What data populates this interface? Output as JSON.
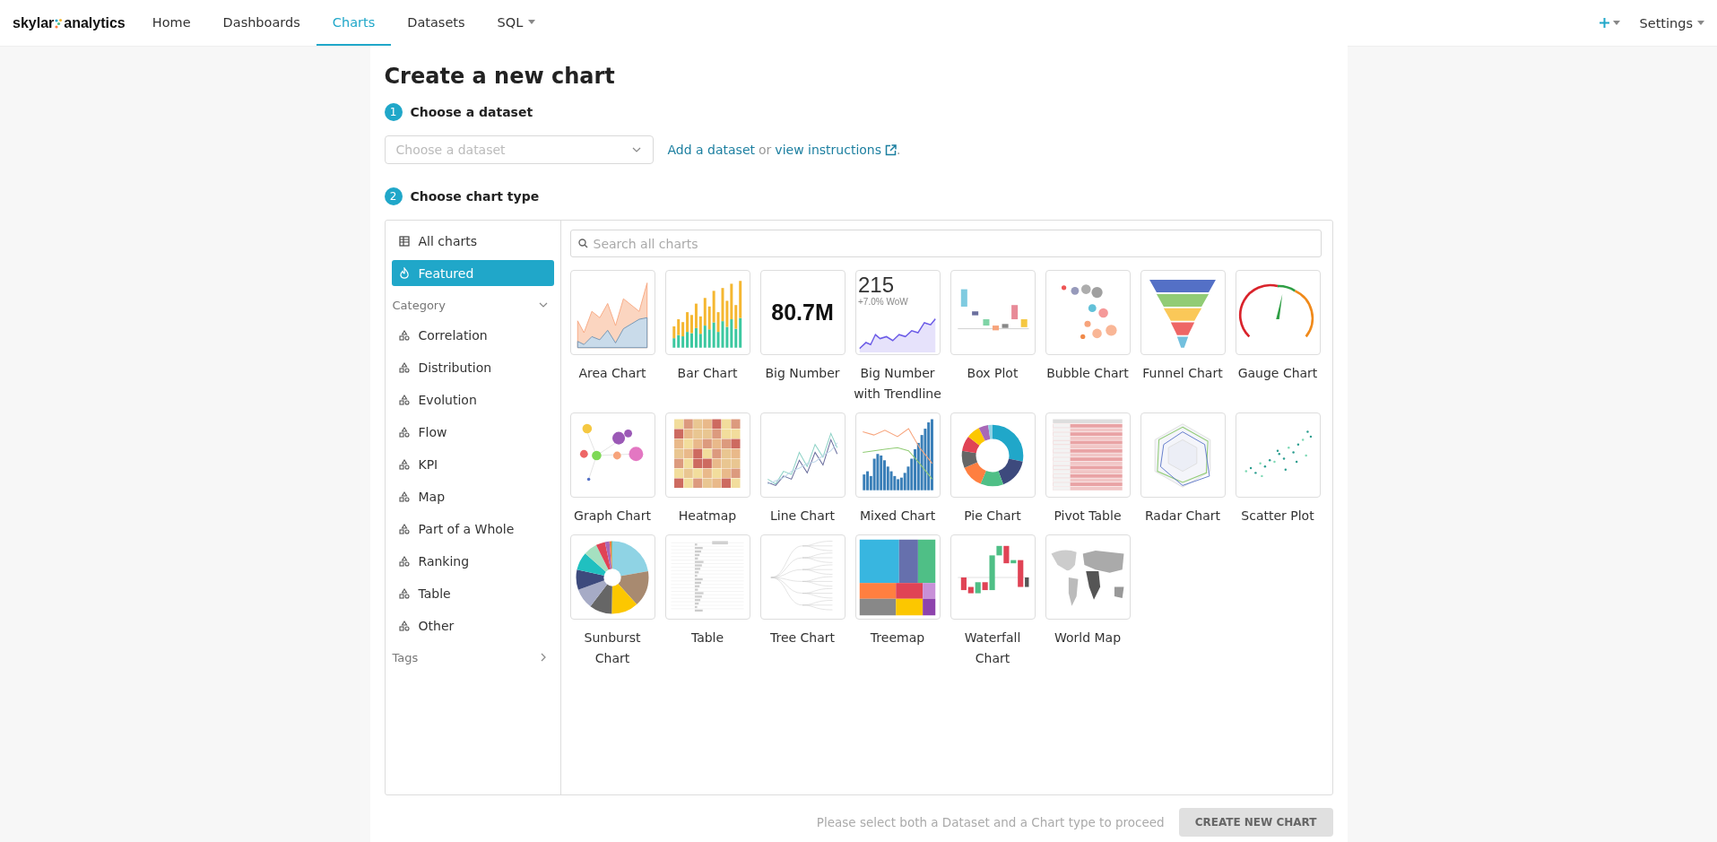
{
  "nav": {
    "brand": {
      "left": "skylar",
      "right": "analytics"
    },
    "items": [
      {
        "label": "Home",
        "selected": false,
        "dropdown": false
      },
      {
        "label": "Dashboards",
        "selected": false,
        "dropdown": false
      },
      {
        "label": "Charts",
        "selected": true,
        "dropdown": false
      },
      {
        "label": "Datasets",
        "selected": false,
        "dropdown": false
      },
      {
        "label": "SQL",
        "selected": false,
        "dropdown": true
      }
    ],
    "settings": "Settings"
  },
  "title": "Create a new chart",
  "steps": [
    {
      "number": "1",
      "label": "Choose a dataset"
    },
    {
      "number": "2",
      "label": "Choose chart type"
    }
  ],
  "dataset_select": {
    "placeholder": "Choose a dataset"
  },
  "dataset_hint": {
    "link_add": "Add a dataset",
    "or": "or",
    "link_instructions": "view instructions",
    "end": "."
  },
  "sidebar": {
    "items": [
      {
        "label": "All charts",
        "kind": "all",
        "selected": false
      },
      {
        "label": "Featured",
        "kind": "featured",
        "selected": true
      }
    ],
    "category": {
      "label": "Category",
      "expanded": true,
      "items": [
        {
          "label": "Correlation",
          "selected": false
        },
        {
          "label": "Distribution",
          "selected": false
        },
        {
          "label": "Evolution",
          "selected": false
        },
        {
          "label": "Flow",
          "selected": false
        },
        {
          "label": "KPI",
          "selected": false
        },
        {
          "label": "Map",
          "selected": false
        },
        {
          "label": "Part of a Whole",
          "selected": false
        },
        {
          "label": "Ranking",
          "selected": false
        },
        {
          "label": "Table",
          "selected": false
        },
        {
          "label": "Other",
          "selected": false
        }
      ]
    },
    "tags": {
      "label": "Tags",
      "expanded": false
    }
  },
  "search": {
    "placeholder": "Search all charts"
  },
  "charts": [
    {
      "label": "Area Chart",
      "kind": "area",
      "selected": false
    },
    {
      "label": "Bar Chart",
      "kind": "bar",
      "selected": false
    },
    {
      "label": "Big Number",
      "kind": "big_number",
      "selected": false,
      "number": "80.7M"
    },
    {
      "label": "Big Number with Trendline",
      "kind": "big_number_trend",
      "selected": false,
      "number": "215",
      "subtitle": "+7.0% WoW"
    },
    {
      "label": "Box Plot",
      "kind": "box",
      "selected": false
    },
    {
      "label": "Bubble Chart",
      "kind": "bubble",
      "selected": false
    },
    {
      "label": "Funnel Chart",
      "kind": "funnel",
      "selected": false
    },
    {
      "label": "Gauge Chart",
      "kind": "gauge",
      "selected": false
    },
    {
      "label": "Graph Chart",
      "kind": "graph",
      "selected": false
    },
    {
      "label": "Heatmap",
      "kind": "heatmap",
      "selected": false
    },
    {
      "label": "Line Chart",
      "kind": "line",
      "selected": false
    },
    {
      "label": "Mixed Chart",
      "kind": "mixed",
      "selected": false
    },
    {
      "label": "Pie Chart",
      "kind": "pie",
      "selected": false
    },
    {
      "label": "Pivot Table",
      "kind": "pivot",
      "selected": false
    },
    {
      "label": "Radar Chart",
      "kind": "radar",
      "selected": false
    },
    {
      "label": "Scatter Plot",
      "kind": "scatter",
      "selected": false
    },
    {
      "label": "Sunburst Chart",
      "kind": "sunburst",
      "selected": false
    },
    {
      "label": "Table",
      "kind": "table",
      "selected": false
    },
    {
      "label": "Tree Chart",
      "kind": "tree",
      "selected": false
    },
    {
      "label": "Treemap",
      "kind": "treemap",
      "selected": false
    },
    {
      "label": "Waterfall Chart",
      "kind": "waterfall",
      "selected": false
    },
    {
      "label": "World Map",
      "kind": "world_map",
      "selected": false
    }
  ],
  "footer": {
    "hint": "Please select both a Dataset and a Chart type to proceed",
    "button": {
      "label": "CREATE NEW CHART",
      "disabled": true
    }
  }
}
